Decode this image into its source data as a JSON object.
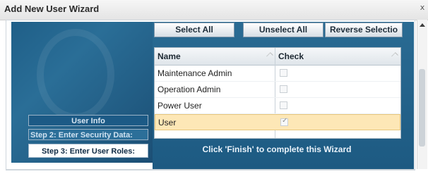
{
  "window": {
    "title": "Add New User Wizard",
    "close_label": "x"
  },
  "toolbar": {
    "select_all": "Select All",
    "unselect_all": "Unselect All",
    "reverse_selection": "Reverse Selectio"
  },
  "grid": {
    "columns": [
      "Name",
      "Check"
    ],
    "rows": [
      {
        "name": "Maintenance Admin",
        "checked": false
      },
      {
        "name": "Operation Admin",
        "checked": false
      },
      {
        "name": "Power User",
        "checked": false
      },
      {
        "name": "User",
        "checked": true
      }
    ],
    "selected_row": "User"
  },
  "steps": {
    "step1": "User Info",
    "step2": "Step 2: Enter Security Data:",
    "step3": "Step 3: Enter User Roles:"
  },
  "footer": {
    "finish_hint": "Click 'Finish' to complete this Wizard"
  },
  "colors": {
    "panel_blue": "#1f5f88",
    "selected_row": "#fde7b6"
  }
}
